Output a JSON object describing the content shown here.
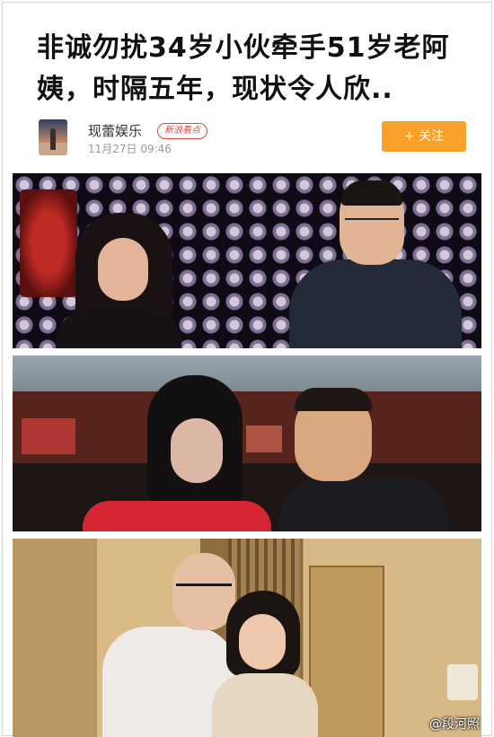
{
  "article": {
    "title": "非诚勿扰34岁小伙牵手51岁老阿姨，时隔五年，现状令人欣.."
  },
  "author": {
    "name": "现蕾娱乐",
    "badge": "新浪看点",
    "time": "11月27日  09:46",
    "follow_label": "+ 关注"
  },
  "colors": {
    "accent": "#f7a12b",
    "badge": "#e2453c"
  },
  "watermark": {
    "text": "@段河照"
  }
}
